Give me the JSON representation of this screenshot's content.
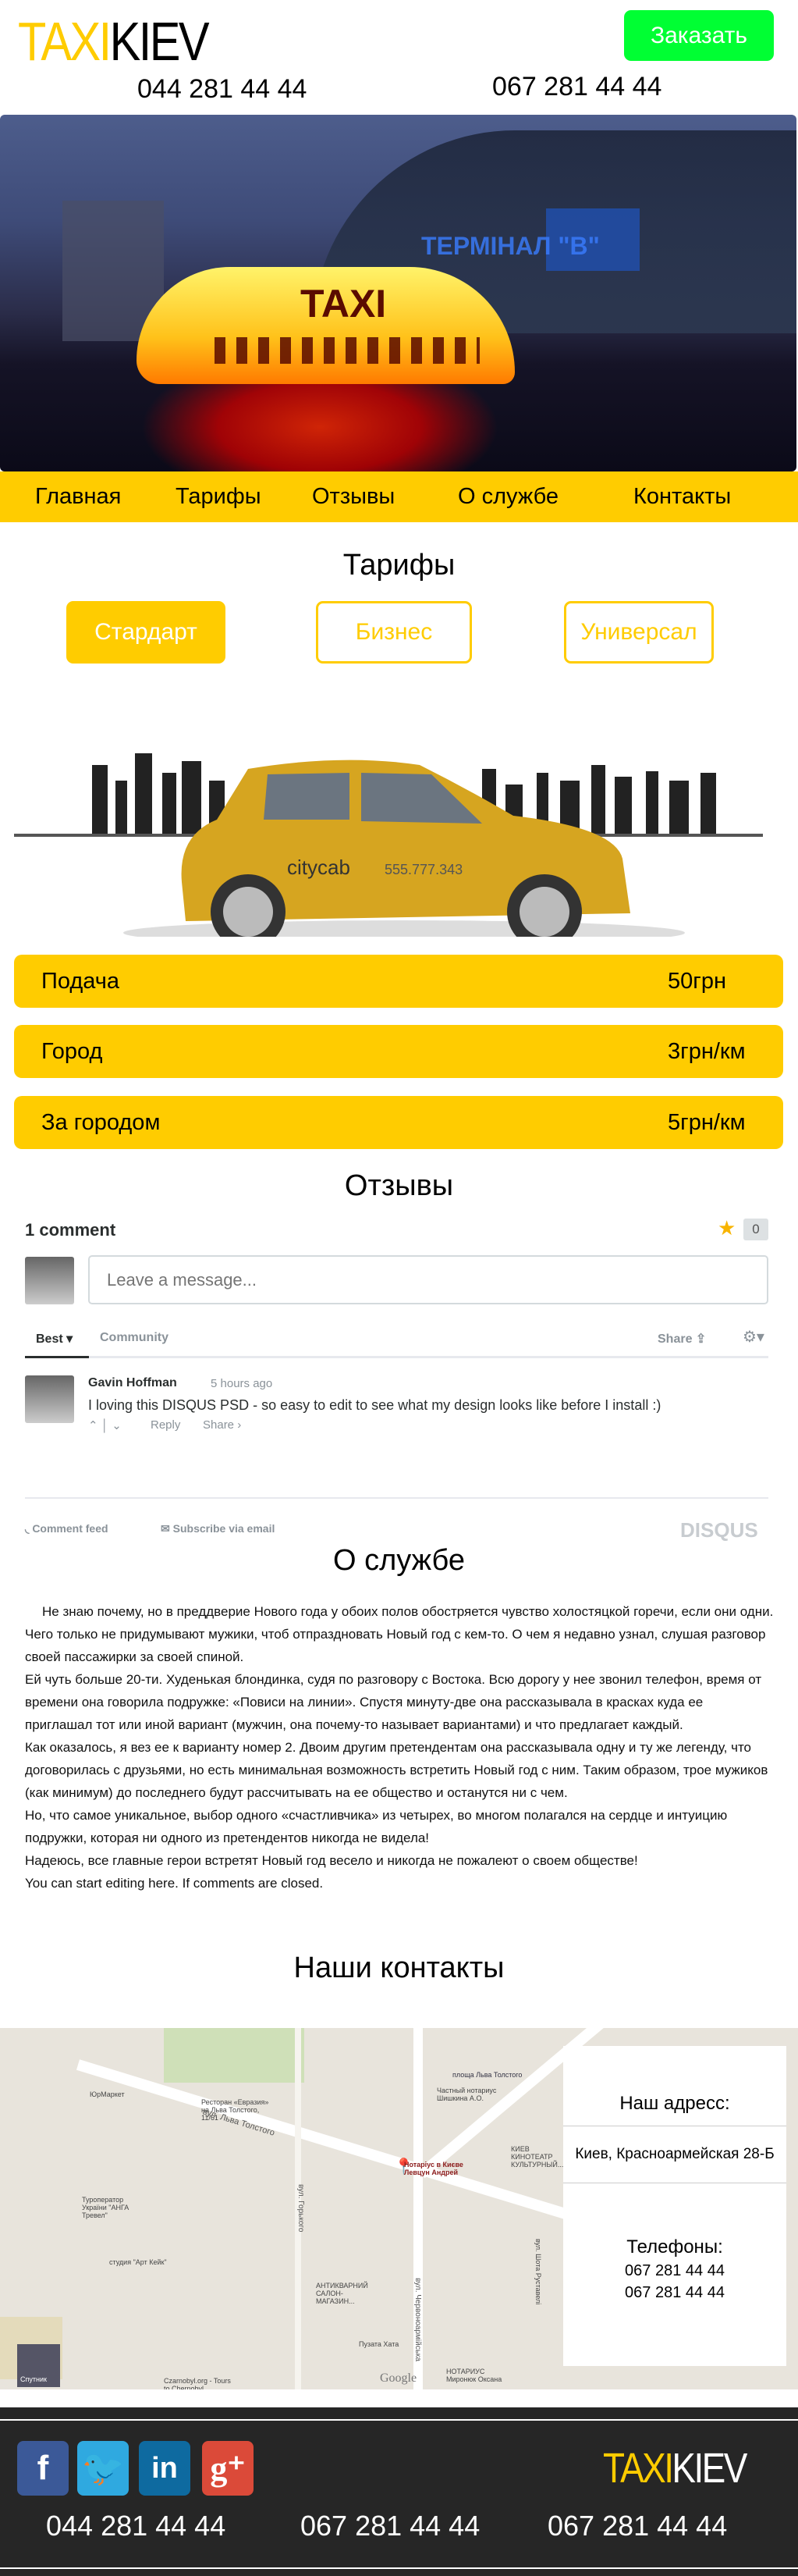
{
  "header": {
    "logo_a": "TAXI",
    "logo_b": "KIEV",
    "order_label": "Заказать",
    "phones": [
      "044 281 44 44",
      "067 281 44 44"
    ]
  },
  "hero": {
    "sign_text": "TAXI",
    "building_text": "ТЕРМІНАЛ \"В\""
  },
  "nav": {
    "items": [
      "Главная",
      "Тарифы",
      "Отзывы",
      "О службе",
      "Контакты"
    ]
  },
  "tariffs": {
    "title": "Тарифы",
    "tabs": [
      "Стардарт",
      "Бизнес",
      "Универсал"
    ],
    "active_tab": 0,
    "car_brand": "citycab",
    "car_phone": "555.777.343",
    "rows": [
      {
        "label": "Подача",
        "value": "50грн"
      },
      {
        "label": "Город",
        "value": "3грн/км"
      },
      {
        "label": "За городом",
        "value": "5грн/км"
      }
    ]
  },
  "reviews": {
    "title": "Отзывы",
    "count_label": "1 comment",
    "star_count": "0",
    "placeholder": "Leave a message...",
    "tab_best": "Best",
    "tab_community": "Community",
    "share": "Share",
    "comment": {
      "author": "Gavin Hoffman",
      "time": "5 hours ago",
      "text": "I loving this DISQUS PSD - so easy to edit to see what my design looks like before I install :)",
      "reply": "Reply",
      "share": "Share ›"
    },
    "comment_feed": "Comment feed",
    "subscribe": "Subscribe via email",
    "brand": "DISQUS"
  },
  "about": {
    "title": "О службе",
    "lines": [
      "Не знаю почему, но в преддверие Нового года у обоих полов обостряется чувство холостяцкой горечи, если они одни. Чего только не придумывают мужики, чтоб отпраздновать Новый год с кем-то. О чем я недавно узнал, слушая разговор своей пассажирки за своей спиной.",
      "Ей чуть больше 20-ти. Худенькая блондинка, судя по разговору с Востока. Всю дорогу у нее звонил телефон, время от времени она говорила подружке: «Повиси на линии». Спустя минуту-две она рассказывала в красках куда ее приглашал тот или иной вариант (мужчин, она почему-то называет вариантами) и что предлагает каждый.",
      "Как оказалось, я вез ее к варианту номер 2. Двоим другим претендентам она рассказывала одну и ту же легенду, что договорилась с друзьями, но есть минимальная возможность встретить Новый год с ним. Таким образом, трое мужиков (как минимум) до последнего будут рассчитывать на ее общество и останутся ни с чем.",
      "Но, что самое уникальное, выбор одного «счастливчика» из четырех, во многом полагался на сердце и интуицию подружки, которая ни одного из претендентов никогда не видела!",
      "Надеюсь, все главные герои встретят Новый год весело и никогда не пожалеют о своем обществе!",
      "You can start editing here. If comments are closed."
    ]
  },
  "contacts": {
    "title": "Наши контакты",
    "address_label": "Наш адресс:",
    "address": "Киев, Красноармейская 28-Б",
    "phones_label": "Телефоны:",
    "phones": [
      "067 281 44 44",
      "067 281 44 44"
    ],
    "map_labels": [
      "вул. Льва Толстого",
      "вул. Горького",
      "вул. Червоноармійська",
      "площа Льва Толстого",
      "Нотаріус в Києве Левцун Андрей",
      "ЮрМаркет",
      "Ресторан «Евразия» на Льва Толстого, 11/61",
      "Туроператор України \"АНГА Тревел\"",
      "студия \"Арт Кейк\"",
      "АНТИКВАРНИЙ САЛОН-МАГАЗИН...",
      "Пузата Хата",
      "НОТАРИУС Миронюк Оксана",
      "Czarnobyl.org - Tours to Chernobyl",
      "Частный нотариус Шишкина А.О.",
      "КИЕВ КИНОТЕАТР КУЛЬТУРНЫЙ...",
      "вул. Шота Руставелі",
      "Google",
      "Спутник"
    ]
  },
  "footer": {
    "logo_a": "TAXI",
    "logo_b": "KIEV",
    "social": [
      "facebook",
      "twitter",
      "linkedin",
      "google-plus"
    ],
    "phones": [
      "044 281 44 44",
      "067 281 44 44",
      "067 281 44 44"
    ]
  },
  "colors": {
    "accent": "#ffcc00",
    "order": "#00ff33",
    "footer": "#262626"
  }
}
